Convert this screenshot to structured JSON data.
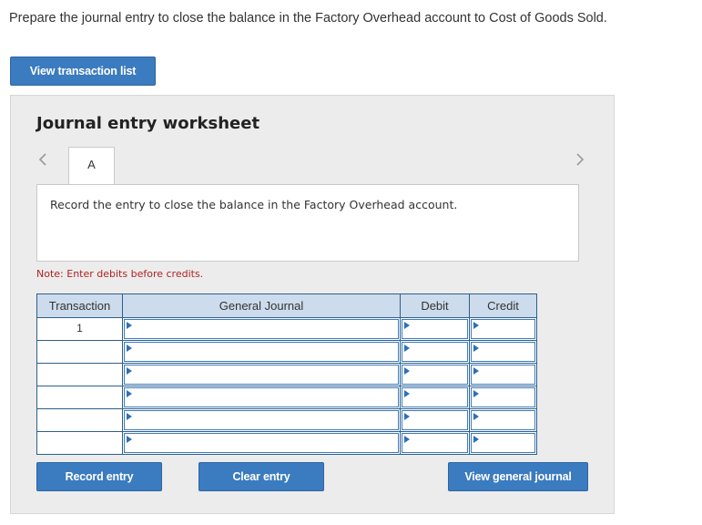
{
  "instruction": "Prepare the journal entry to close the balance in the Factory Overhead account to Cost of Goods Sold.",
  "buttons": {
    "view_transaction_list": "View transaction list",
    "record_entry": "Record entry",
    "clear_entry": "Clear entry",
    "view_general_journal": "View general journal"
  },
  "worksheet": {
    "title": "Journal entry worksheet",
    "tabs": [
      {
        "label": "A"
      }
    ],
    "description": "Record the entry to close the balance in the Factory Overhead account.",
    "note": "Note: Enter debits before credits."
  },
  "table": {
    "headers": {
      "transaction": "Transaction",
      "general_journal": "General Journal",
      "debit": "Debit",
      "credit": "Credit"
    },
    "rows": [
      {
        "transaction": "1",
        "account": "",
        "debit": "",
        "credit": ""
      },
      {
        "transaction": "",
        "account": "",
        "debit": "",
        "credit": ""
      },
      {
        "transaction": "",
        "account": "",
        "debit": "",
        "credit": ""
      },
      {
        "transaction": "",
        "account": "",
        "debit": "",
        "credit": ""
      },
      {
        "transaction": "",
        "account": "",
        "debit": "",
        "credit": ""
      },
      {
        "transaction": "",
        "account": "",
        "debit": "",
        "credit": ""
      }
    ]
  },
  "icons": {
    "prev": "chevron-left-icon",
    "next": "chevron-right-icon",
    "dropdown": "dropdown-triangle-icon"
  },
  "colors": {
    "button": "#3b7bbf",
    "header_fill": "#ccdcec",
    "note": "#b22222",
    "panel": "#ececec"
  }
}
